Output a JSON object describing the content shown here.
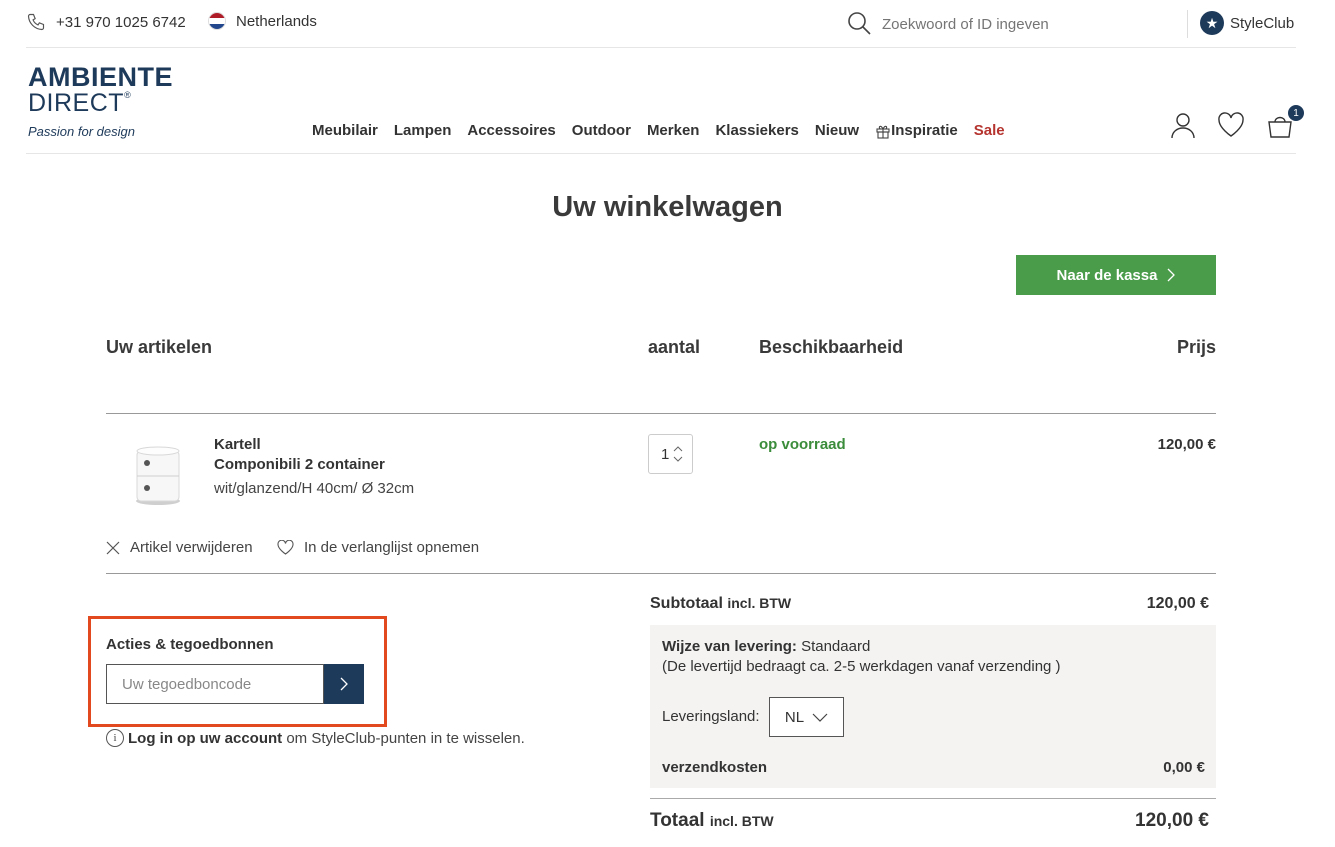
{
  "topbar": {
    "phone": "+31 970 1025 6742",
    "country": "Netherlands",
    "search_placeholder": "Zoekwoord of ID ingeven",
    "styleclub": "StyleClub"
  },
  "logo": {
    "line1": "AMBIENTE",
    "line2": "DIRECT",
    "registered": "®",
    "tagline": "Passion for design"
  },
  "nav": {
    "items": [
      "Meubilair",
      "Lampen",
      "Accessoires",
      "Outdoor",
      "Merken",
      "Klassiekers",
      "Nieuw"
    ],
    "inspiratie": "Inspiratie",
    "sale": "Sale"
  },
  "cart_badge": "1",
  "page": {
    "title": "Uw winkelwagen",
    "checkout_label": "Naar de kassa"
  },
  "table": {
    "col_articles": "Uw artikelen",
    "col_qty": "aantal",
    "col_availability": "Beschikbaarheid",
    "col_price": "Prijs"
  },
  "item": {
    "brand": "Kartell",
    "name": "Componibili 2 container",
    "variant": "wit/glanzend/H 40cm/ Ø 32cm",
    "quantity": "1",
    "availability": "op voorraad",
    "price": "120,00 €",
    "remove_label": "Artikel verwijderen",
    "wishlist_label": "In de verlanglijst opnemen"
  },
  "promo": {
    "title": "Acties & tegoedbonnen",
    "placeholder": "Uw tegoedboncode",
    "login_link": "Log in op uw account",
    "login_rest": " om StyleClub-punten in te wisselen."
  },
  "summary": {
    "subtotal_label": "Subtotaal",
    "subtotal_suffix": "incl. BTW",
    "subtotal_value": "120,00 €",
    "delivery_label": "Wijze van levering:",
    "delivery_value": "Standaard",
    "delivery_note": "(De levertijd bedraagt ca. 2-5 werkdagen vanaf verzending )",
    "country_label": "Leveringsland:",
    "country_value": "NL",
    "shipping_label": "verzendkosten",
    "shipping_value": "0,00 €",
    "total_label": "Totaal",
    "total_suffix": "incl. BTW",
    "total_value": "120,00 €"
  },
  "colors": {
    "brand": "#1e3a5a",
    "checkout_green": "#4a9c4a",
    "stock_green": "#3b8c3b",
    "sale_red": "#b5342f",
    "highlight": "#e2491f"
  }
}
